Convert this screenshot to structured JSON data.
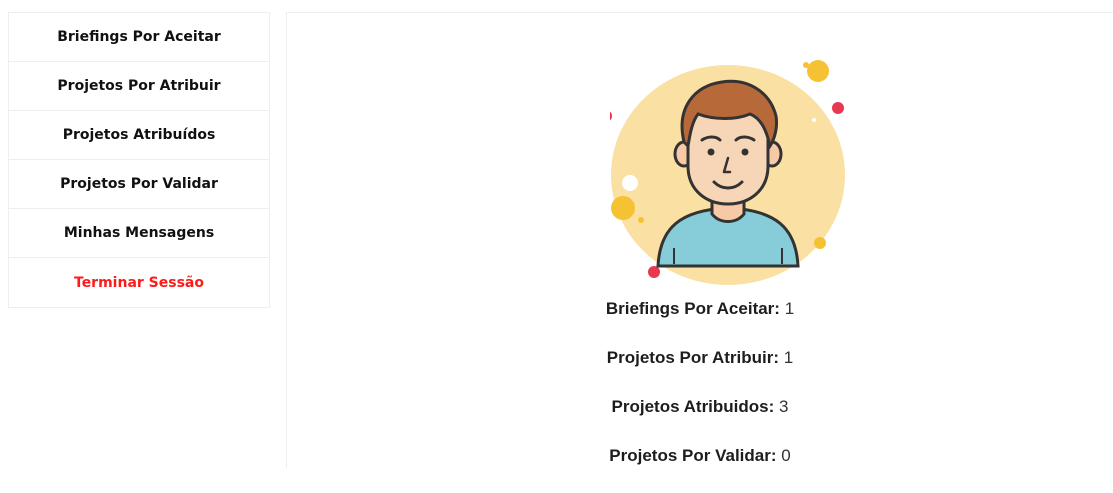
{
  "sidebar": {
    "items": [
      {
        "label": "Briefings Por Aceitar"
      },
      {
        "label": "Projetos Por Atribuir"
      },
      {
        "label": "Projetos Atribuídos"
      },
      {
        "label": "Projetos Por Validar"
      },
      {
        "label": "Minhas Mensagens"
      },
      {
        "label": "Terminar Sessão"
      }
    ]
  },
  "main": {
    "stats": [
      {
        "label": "Briefings Por Aceitar:",
        "value": "1"
      },
      {
        "label": "Projetos Por Atribuir:",
        "value": "1"
      },
      {
        "label": "Projetos Atribuidos:",
        "value": "3"
      },
      {
        "label": "Projetos Por Validar:",
        "value": "0"
      }
    ]
  },
  "colors": {
    "logout": "#ff1a1a",
    "avatar_bg": "#fbe0a3",
    "accent_dot_red": "#e8384f",
    "accent_dot_yellow": "#f5c233"
  },
  "icons": {
    "avatar": "user-avatar-illustration"
  }
}
